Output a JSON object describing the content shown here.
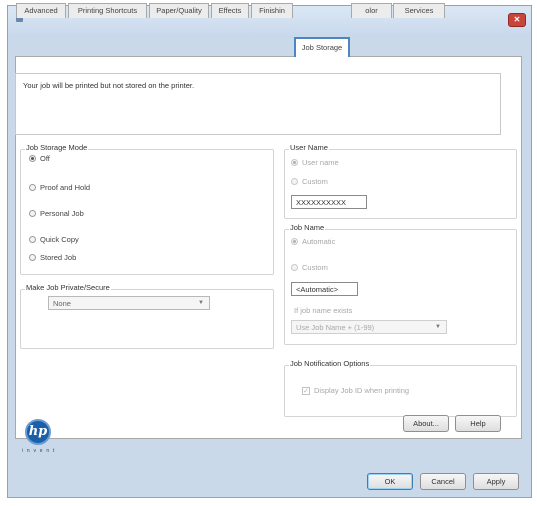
{
  "window": {
    "close_label": "✕"
  },
  "tabs": [
    {
      "label": "Advanced",
      "active": false
    },
    {
      "label": "Printing Shortcuts",
      "active": false
    },
    {
      "label": "Paper/Quality",
      "active": false
    },
    {
      "label": "Effects",
      "active": false
    },
    {
      "label": "Finishin",
      "active": false
    },
    {
      "label": "Job Storage",
      "active": true
    },
    {
      "label": "olor",
      "active": false
    },
    {
      "label": "Services",
      "active": false
    }
  ],
  "message": "Your job will be printed but not stored on the printer.",
  "job_storage_mode": {
    "label": "Job Storage Mode",
    "options": [
      "Off",
      "Proof and Hold",
      "Personal Job",
      "Quick Copy",
      "Stored Job"
    ],
    "selected": "Off"
  },
  "private_secure": {
    "label": "Make Job Private/Secure",
    "value": "None"
  },
  "user_name": {
    "label": "User Name",
    "options": [
      "User name",
      "Custom"
    ],
    "selected": "User name",
    "value": "XXXXXXXXXX"
  },
  "job_name": {
    "label": "Job Name",
    "options": [
      "Automatic",
      "Custom"
    ],
    "selected": "Automatic",
    "value": "<Automatic>",
    "exists_label": "If job name exists",
    "exists_value": "Use Job Name + (1-99)"
  },
  "notification": {
    "label": "Job Notification Options",
    "checkbox_label": "Display Job ID when printing",
    "checked": true
  },
  "logo": {
    "text": "hp",
    "tagline": "i n v e n t"
  },
  "buttons": {
    "about": "About...",
    "help": "Help",
    "ok": "OK",
    "cancel": "Cancel",
    "apply": "Apply"
  }
}
